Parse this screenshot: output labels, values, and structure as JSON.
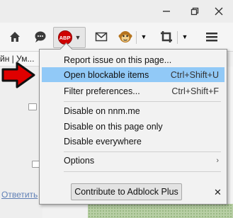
{
  "toolbar": {
    "abp_logo_text": "ABP"
  },
  "page": {
    "strip_text": "йн | Ум...",
    "reply_link": "Ответить"
  },
  "popup": {
    "items": [
      {
        "label": "Report issue on this page...",
        "shortcut": ""
      },
      {
        "label": "Open blockable items",
        "shortcut": "Ctrl+Shift+U"
      },
      {
        "label": "Filter preferences...",
        "shortcut": "Ctrl+Shift+F"
      },
      {
        "label": "Disable on nnm.me",
        "shortcut": ""
      },
      {
        "label": "Disable on this page only",
        "shortcut": ""
      },
      {
        "label": "Disable everywhere",
        "shortcut": ""
      },
      {
        "label": "Options",
        "shortcut": ""
      }
    ],
    "contribute_label": "Contribute to Adblock Plus",
    "close_glyph": "✕"
  },
  "colors": {
    "highlight": "#91c9f7",
    "abp_red": "#cf0000",
    "arrow_red": "#e00000"
  }
}
